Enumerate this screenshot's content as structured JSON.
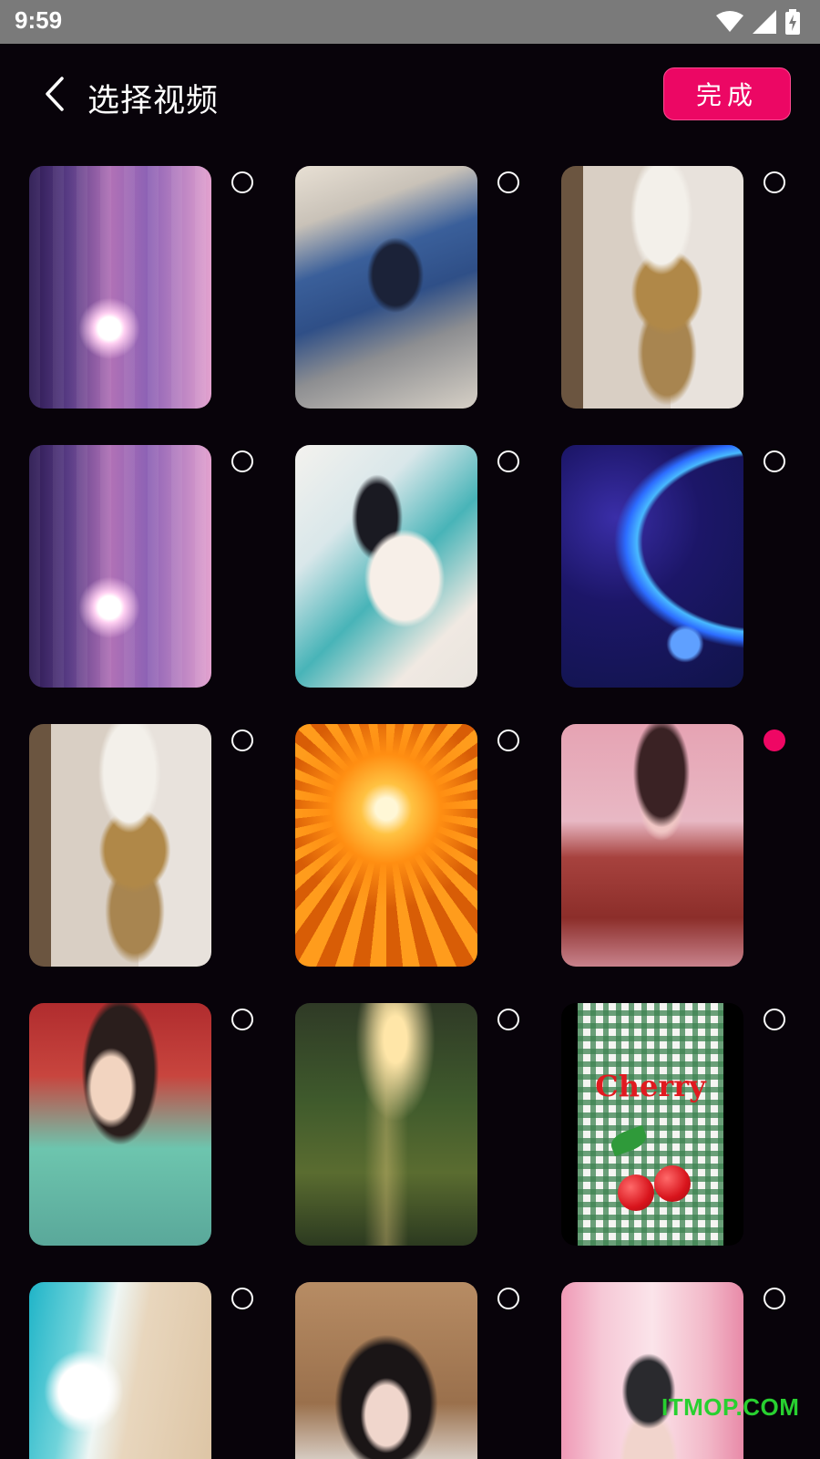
{
  "status_bar": {
    "time": "9:59",
    "icons": [
      "wifi-icon",
      "cellular-signal-icon",
      "battery-charging-icon"
    ]
  },
  "header": {
    "back_icon": "chevron-left-icon",
    "title": "选择视频",
    "done_label": "完成"
  },
  "colors": {
    "accent": "#ec0764",
    "background": "#08030a",
    "status_bar": "#7a7a7a"
  },
  "videos": [
    {
      "thumbnail": "sunset-torii",
      "selected": false
    },
    {
      "thumbnail": "anime-girl-lying",
      "selected": false
    },
    {
      "thumbnail": "cats-sideways",
      "selected": false
    },
    {
      "thumbnail": "sunset-torii",
      "selected": false
    },
    {
      "thumbnail": "shrine-maiden",
      "selected": false
    },
    {
      "thumbnail": "space-planet",
      "selected": false
    },
    {
      "thumbnail": "cats-sideways",
      "selected": false
    },
    {
      "thumbnail": "orange-burst",
      "selected": false
    },
    {
      "thumbnail": "girl-at-table",
      "selected": true
    },
    {
      "thumbnail": "kimono-girl",
      "selected": false
    },
    {
      "thumbnail": "forest-light",
      "selected": false
    },
    {
      "thumbnail": "cherry-gingham",
      "selected": false,
      "caption": "Cherry"
    },
    {
      "thumbnail": "beach-wave",
      "selected": false
    },
    {
      "thumbnail": "anime-girl-portrait",
      "selected": false
    },
    {
      "thumbnail": "pink-room-legs",
      "selected": false
    }
  ],
  "watermark": "ITMOP.COM"
}
